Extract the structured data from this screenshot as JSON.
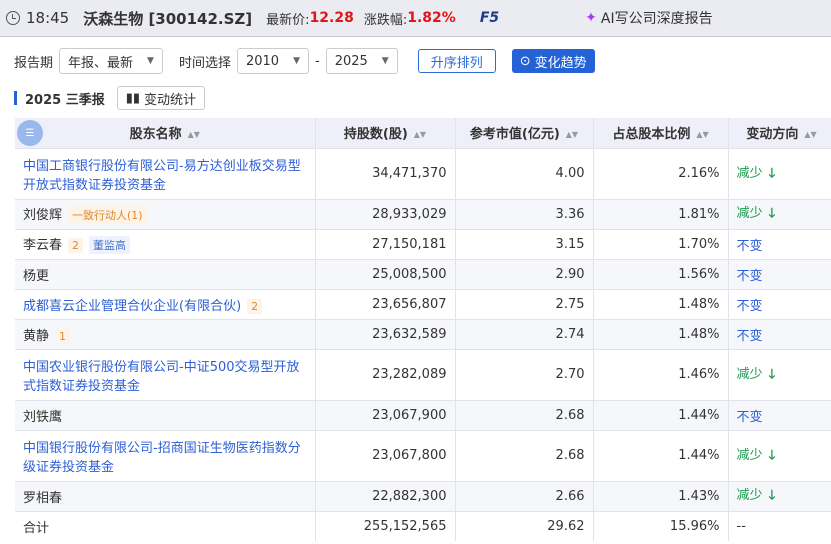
{
  "header": {
    "time": "18:45",
    "stock": "沃森生物 [300142.SZ]",
    "price_label": "最新价:",
    "price": "12.28",
    "change_label": "涨跌幅:",
    "change": "1.82%",
    "f5": "F5",
    "ai": "AI写公司深度报告"
  },
  "filters": {
    "period_label": "报告期",
    "period": "年报、最新",
    "time_label": "时间选择",
    "from": "2010",
    "sep": "-",
    "to": "2025",
    "asc": "升序排列",
    "trend": "变化趋势"
  },
  "section": {
    "title": "2025 三季报",
    "stat_btn": "变动统计"
  },
  "table": {
    "headers": [
      "股东名称",
      "持股数(股)",
      "参考市值(亿元)",
      "占总股本比例",
      "变动方向"
    ],
    "rows": [
      {
        "name": "中国工商银行股份有限公司-易方达创业板交易型开放式指数证券投资基金",
        "shares": "34,471,370",
        "value": "4.00",
        "ratio": "2.16%",
        "dir": "减少"
      },
      {
        "name": "刘俊辉",
        "tag1": "一致行动人(1)",
        "shares": "28,933,029",
        "value": "3.36",
        "ratio": "1.81%",
        "dir": "减少"
      },
      {
        "name": "李云春",
        "tag1": "2",
        "tag2": "董监高",
        "shares": "27,150,181",
        "value": "3.15",
        "ratio": "1.70%",
        "dir": "不变"
      },
      {
        "name": "杨更",
        "shares": "25,008,500",
        "value": "2.90",
        "ratio": "1.56%",
        "dir": "不变"
      },
      {
        "name": "成都喜云企业管理合伙企业(有限合伙)",
        "tag1": "2",
        "shares": "23,656,807",
        "value": "2.75",
        "ratio": "1.48%",
        "dir": "不变"
      },
      {
        "name": "黄静",
        "tag1": "1",
        "shares": "23,632,589",
        "value": "2.74",
        "ratio": "1.48%",
        "dir": "不变"
      },
      {
        "name": "中国农业银行股份有限公司-中证500交易型开放式指数证券投资基金",
        "shares": "23,282,089",
        "value": "2.70",
        "ratio": "1.46%",
        "dir": "减少"
      },
      {
        "name": "刘铁鹰",
        "shares": "23,067,900",
        "value": "2.68",
        "ratio": "1.44%",
        "dir": "不变"
      },
      {
        "name": "中国银行股份有限公司-招商国证生物医药指数分级证券投资基金",
        "shares": "23,067,800",
        "value": "2.68",
        "ratio": "1.44%",
        "dir": "减少"
      },
      {
        "name": "罗相春",
        "shares": "22,882,300",
        "value": "2.66",
        "ratio": "1.43%",
        "dir": "减少"
      }
    ],
    "total": {
      "name": "合计",
      "shares": "255,152,565",
      "value": "29.62",
      "ratio": "15.96%",
      "dir": "--"
    }
  }
}
